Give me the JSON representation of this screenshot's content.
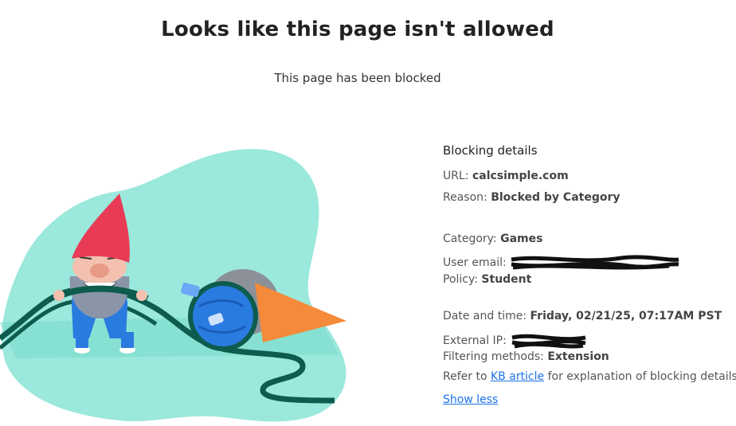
{
  "page": {
    "title": "Looks like this page isn't allowed",
    "subtitle": "This page has been blocked"
  },
  "details": {
    "heading": "Blocking details",
    "url_label": "URL:",
    "url_value": "calcsimple.com",
    "reason_label": "Reason:",
    "reason_value": "Blocked by Category",
    "category_label": "Category:",
    "category_value": "Games",
    "user_email_label": "User email:",
    "policy_label": "Policy:",
    "policy_value": "Student",
    "datetime_label": "Date and time:",
    "datetime_value": "Friday, 02/21/25, 07:17AM PST",
    "external_ip_label": "External IP:",
    "filtering_label": "Filtering methods:",
    "filtering_value": "Extension",
    "refer_prefix": "Refer to",
    "kb_link": "KB article",
    "refer_suffix": "for explanation of blocking details",
    "show_less": "Show less"
  },
  "colors": {
    "accent_link": "#1a73e8",
    "blob": "#9be8dc",
    "hose": "#0d5c4e",
    "gnome_hat": "#e83b55",
    "gnome_suit": "#2a7be0",
    "cone": "#f48a3a"
  },
  "icons": {
    "illustration": "gnome-with-hose-illustration",
    "redaction_email": "redaction-scribble",
    "redaction_ip": "redaction-scribble"
  }
}
